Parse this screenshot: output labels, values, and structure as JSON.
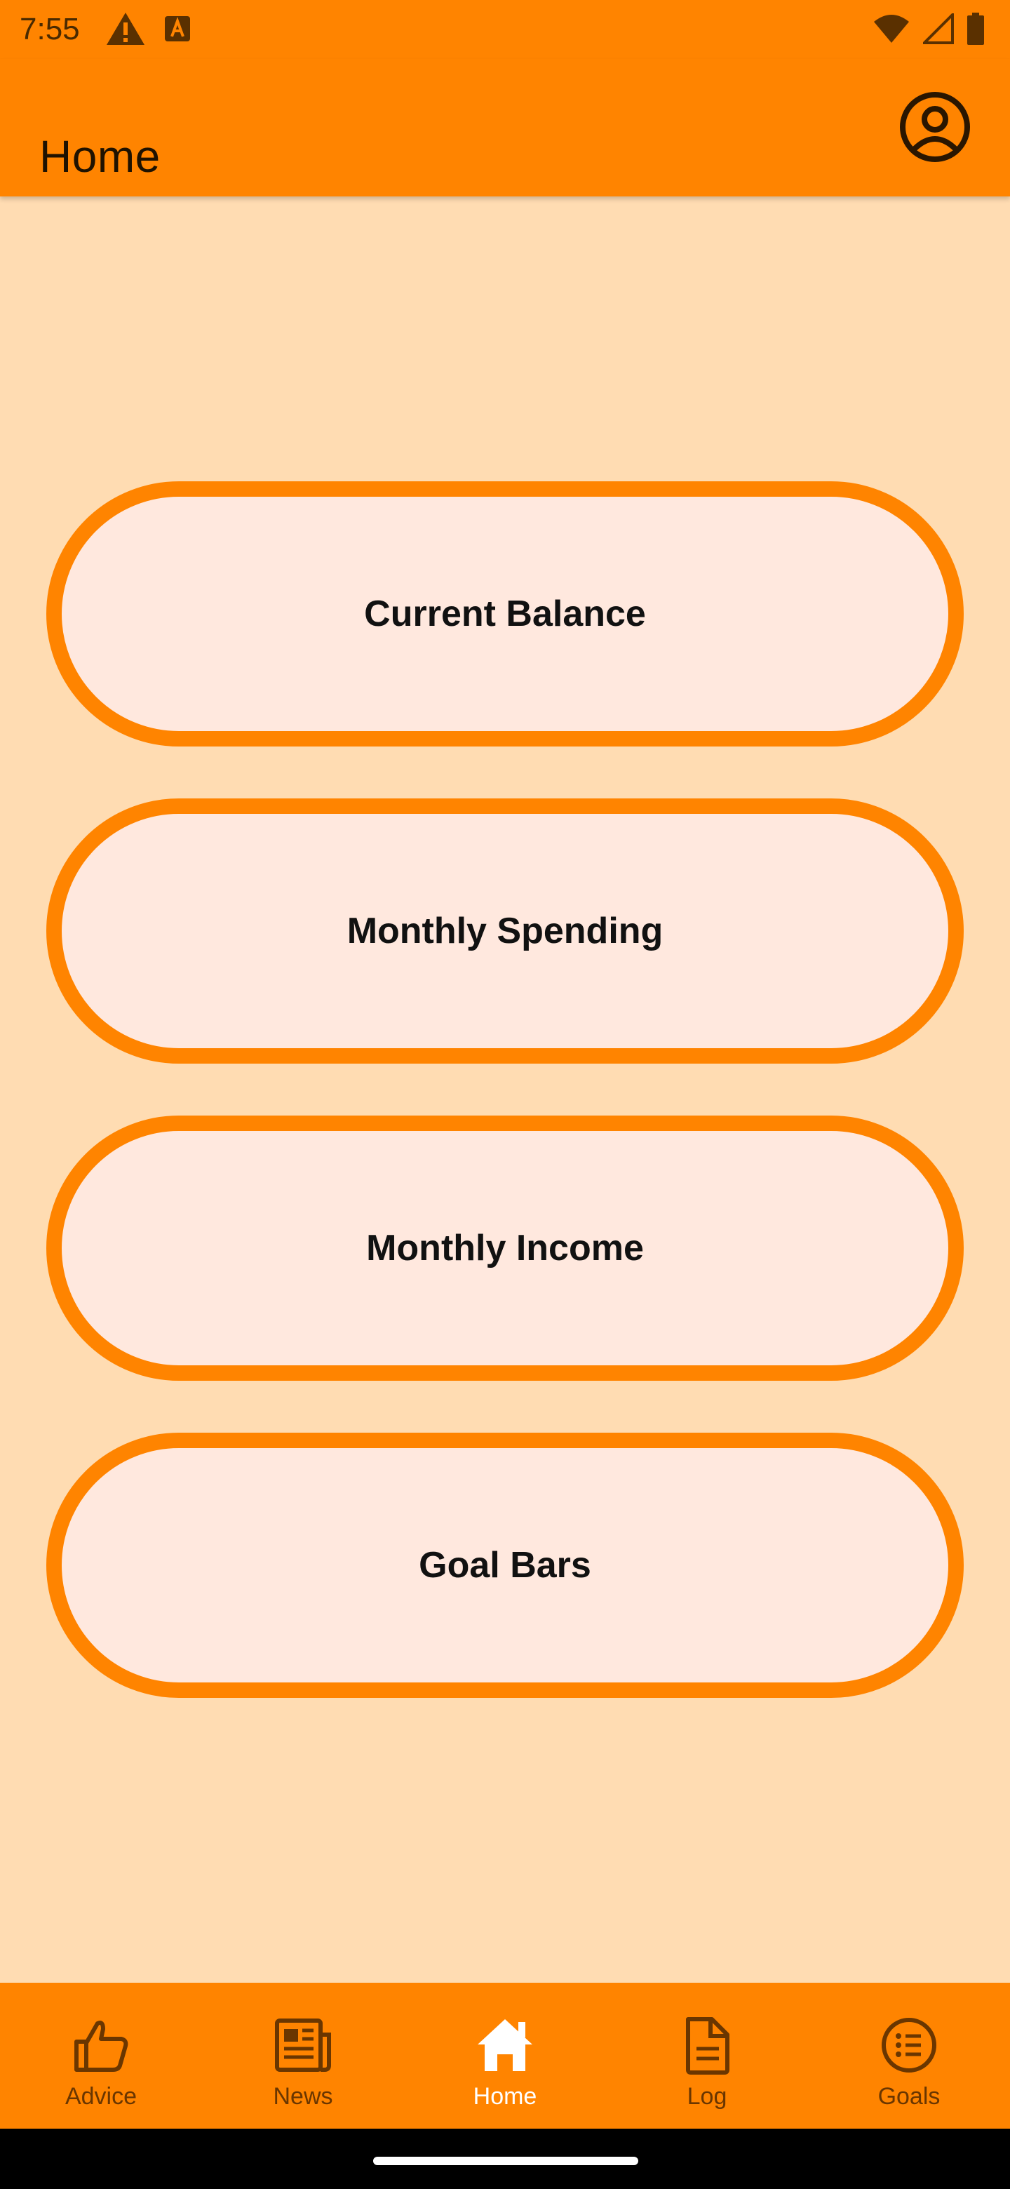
{
  "status_bar": {
    "time": "7:55",
    "icons": [
      "warning-icon",
      "font-a-icon",
      "wifi-icon",
      "signal-icon",
      "battery-icon"
    ]
  },
  "app_bar": {
    "title": "Home",
    "account_icon": "account-circle-icon"
  },
  "cards": [
    {
      "label": "Current Balance"
    },
    {
      "label": "Monthly Spending"
    },
    {
      "label": "Monthly Income"
    },
    {
      "label": "Goal Bars"
    }
  ],
  "bottom_nav": {
    "items": [
      {
        "label": "Advice",
        "icon": "thumbs-up-icon",
        "active": false
      },
      {
        "label": "News",
        "icon": "newspaper-icon",
        "active": false
      },
      {
        "label": "Home",
        "icon": "home-icon",
        "active": true
      },
      {
        "label": "Log",
        "icon": "document-icon",
        "active": false
      },
      {
        "label": "Goals",
        "icon": "list-icon",
        "active": false
      }
    ]
  },
  "colors": {
    "primary": "#FF8400",
    "background": "#FFDCB2",
    "card_fill": "#FFE8DE",
    "nav_inactive": "#6A3600",
    "nav_active": "#FFFFFF"
  }
}
